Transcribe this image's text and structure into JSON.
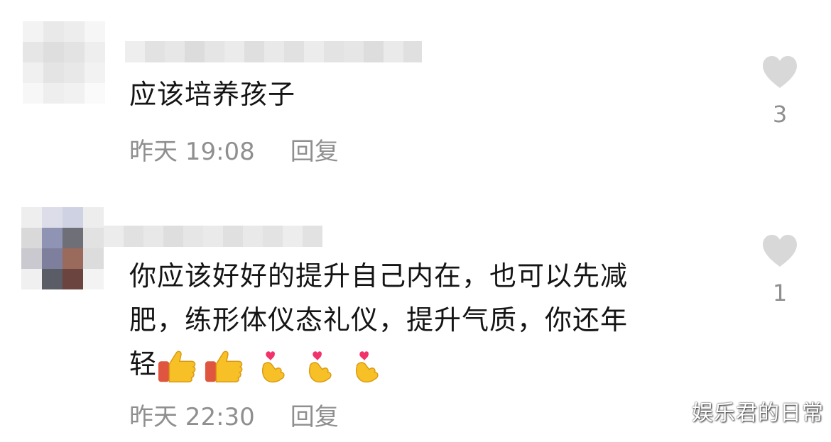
{
  "comments": [
    {
      "text": "应该培养孩子",
      "time": "昨天 19:08",
      "reply_label": "回复",
      "like_count": "3"
    },
    {
      "text_line1": "你应该好好的提升自己内在，也可以先减",
      "text_line2": "肥，练形体仪态礼仪，提升气质，你还年",
      "text_line3": "轻",
      "emojis": [
        "thumbs-up",
        "thumbs-up",
        "finger-heart",
        "finger-heart",
        "finger-heart"
      ],
      "time": "昨天 22:30",
      "reply_label": "回复",
      "like_count": "1"
    }
  ],
  "watermark": "娱乐君的日常",
  "icons": {
    "like": "heart-icon"
  },
  "colors": {
    "text": "#141414",
    "meta": "#8f8f8f",
    "heart": "#d8d8d8"
  }
}
